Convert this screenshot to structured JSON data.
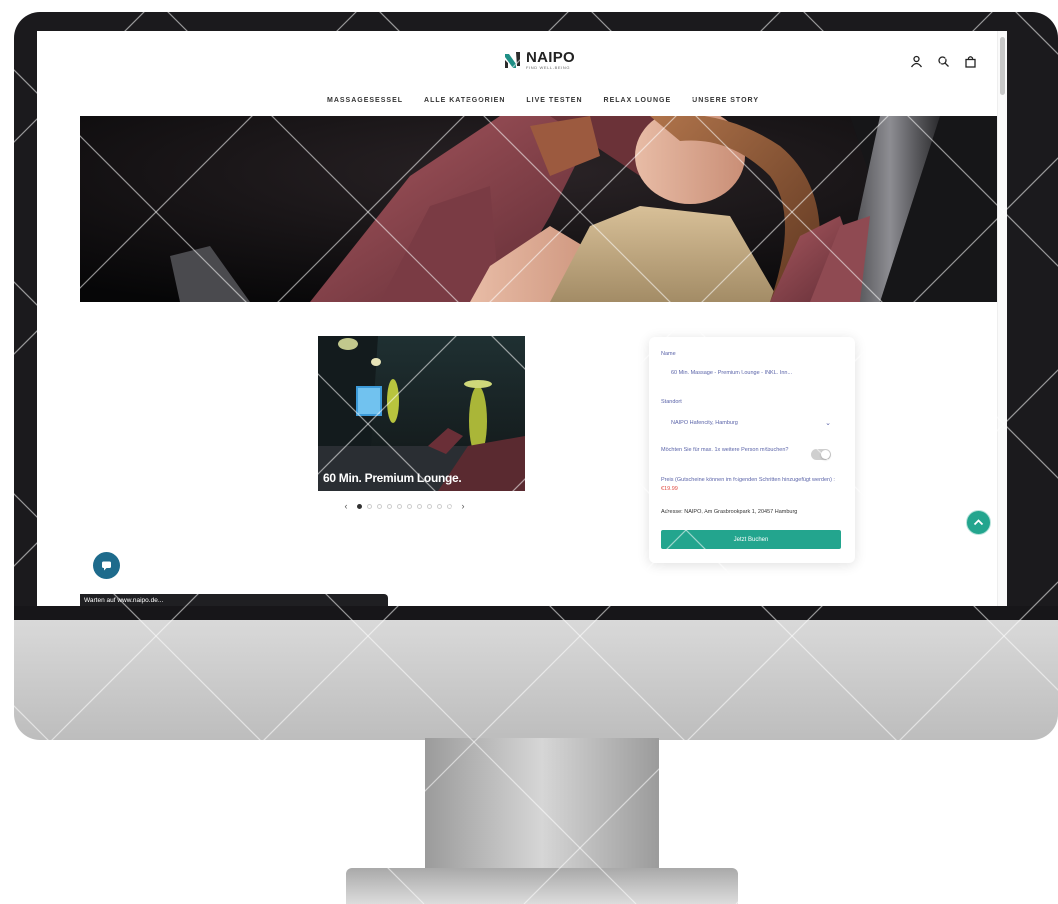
{
  "brand": {
    "name": "NAIPO",
    "tagline": "FIND WELL-BEING"
  },
  "header_icons": [
    "user-icon",
    "search-icon",
    "cart-icon"
  ],
  "nav": {
    "items": [
      {
        "label": "MASSAGESESSEL"
      },
      {
        "label": "ALLE KATEGORIEN"
      },
      {
        "label": "LIVE TESTEN"
      },
      {
        "label": "RELAX LOUNGE"
      },
      {
        "label": "UNSERE STORY"
      }
    ]
  },
  "slider": {
    "caption": "60 Min. Premium Lounge.",
    "dot_count": 10,
    "active_dot": 1,
    "prev": "‹",
    "next": "›"
  },
  "booking": {
    "name_label": "Name",
    "name_value": "60 Min. Massage - Premium Lounge - INKL. Inn...",
    "location_label": "Standort",
    "location_value": "NAIPO Hafencity, Hamburg",
    "extra_person_label": "Möchten Sie für max. 1x weitere Person mitbuchen?",
    "extra_person_enabled": false,
    "price_label": "Preis (Gutscheine können im folgenden Schritten hinzugefügt werden) :",
    "price_value": "€19.99",
    "address": "Adresse: NAIPO, Am Grasbrookpark 1, 20457 Hamburg",
    "book_button": "Jetzt Buchen"
  },
  "status_bar": "Warten auf www.naipo.de...",
  "colors": {
    "accent": "#23a58e",
    "label": "#5a63a8",
    "price": "#e0483f",
    "chat": "#1e6b8c"
  }
}
